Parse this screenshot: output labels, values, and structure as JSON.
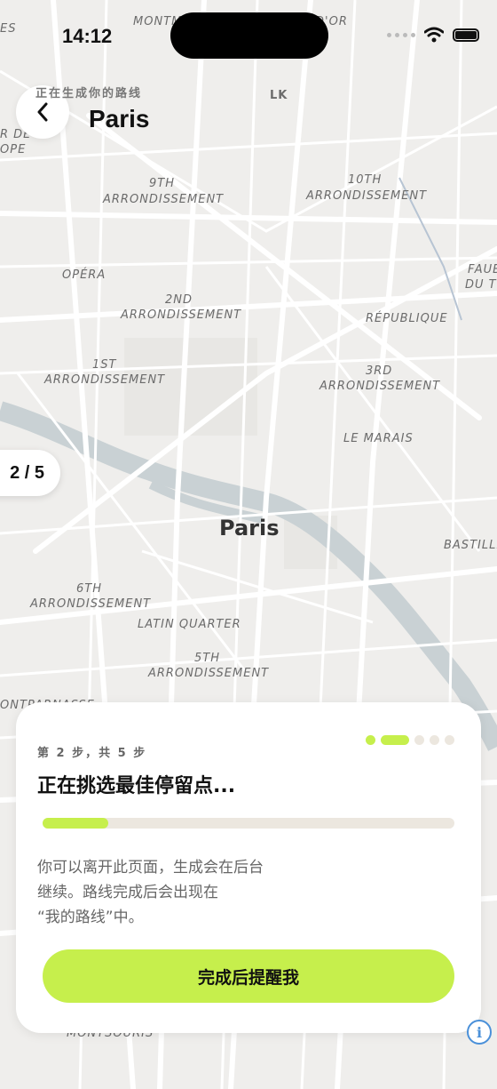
{
  "status": {
    "time": "14:12"
  },
  "header": {
    "subtitle": "正在生成你的路线",
    "title": "Paris"
  },
  "step_pill": "2 / 5",
  "map": {
    "city": "Paris",
    "labels": {
      "montmartre_fragment": "MONTM",
      "dor_fragment": "D'OR",
      "es_fragment": "ES",
      "lk": "LK",
      "rde_fragment": "R DE",
      "ope_fragment": "OPE",
      "arr9_a": "9TH",
      "arr9_b": "ARRONDISSEMENT",
      "arr10_a": "10TH",
      "arr10_b": "ARRONDISSEMENT",
      "faub_a": "FAUB",
      "faub_b": "DU T",
      "opera": "OPÉRA",
      "arr2_a": "2ND",
      "arr2_b": "ARRONDISSEMENT",
      "republique": "RÉPUBLIQUE",
      "arr1_a": "1ST",
      "arr1_b": "ARRONDISSEMENT",
      "arr3_a": "3RD",
      "arr3_b": "ARRONDISSEMENT",
      "marais": "LE MARAIS",
      "bastille": "BASTILLE",
      "arr6_a": "6TH",
      "arr6_b": "ARRONDISSEMENT",
      "latin": "LATIN QUARTER",
      "arr5_a": "5TH",
      "arr5_b": "ARRONDISSEMENT",
      "montparnasse": "ONTPARNASSE",
      "montsouris": "MONTSOURIS"
    }
  },
  "card": {
    "step_text": "第 2 步，共 5 步",
    "title": "正在挑选最佳停留点...",
    "progress": 0.16,
    "desc_line1": "你可以离开此页面，生成会在后台",
    "desc_line2": "继续。路线完成后会出现在",
    "desc_line3": "“我的路线”中。",
    "cta": "完成后提醒我",
    "step_current": 2,
    "step_total": 5
  },
  "colors": {
    "accent": "#c6ef4c",
    "map_bg": "#efeeec",
    "river": "#c9d1d4"
  },
  "icons": {
    "back": "chevron-left-icon",
    "wifi": "wifi-icon",
    "battery": "battery-icon",
    "info": "info-icon"
  }
}
